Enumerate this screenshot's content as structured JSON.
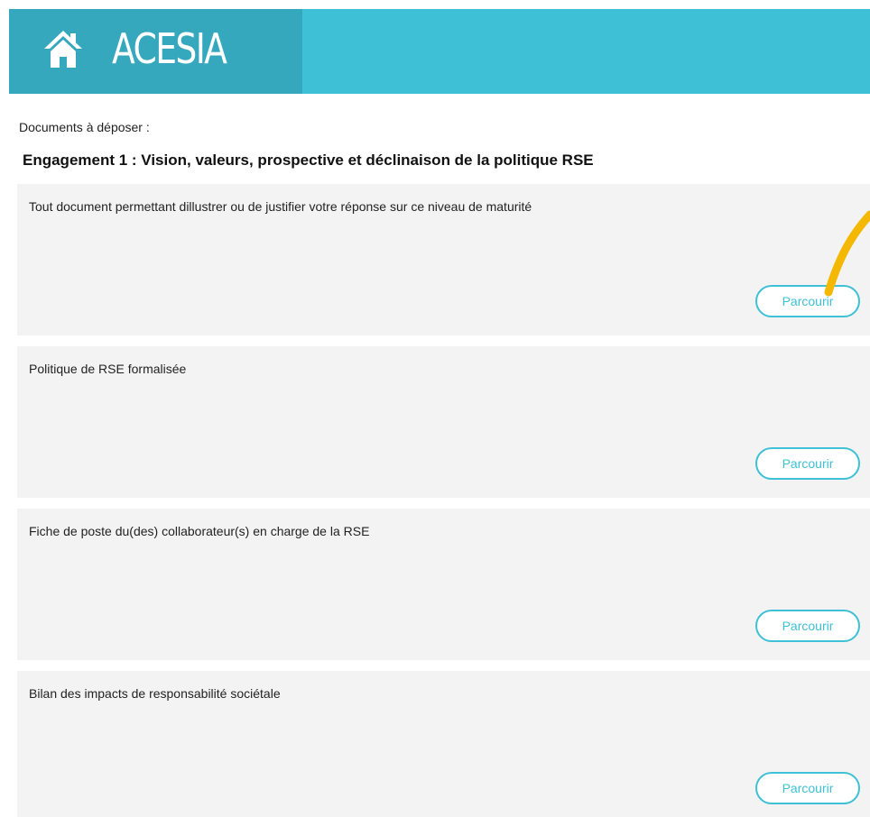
{
  "header": {
    "app_title": "ACESIA",
    "home_icon": "home-icon",
    "accent_color": "#3ec0d6",
    "logo_bg_color": "#35a8bd"
  },
  "main": {
    "documents_label": "Documents à déposer :",
    "section_title": "Engagement 1 : Vision, valeurs, prospective et déclinaison de la politique RSE",
    "documents": [
      {
        "label": "Tout document permettant dillustrer ou de justifier votre réponse sur ce niveau de maturité",
        "button_label": "Parcourir"
      },
      {
        "label": "Politique de RSE formalisée",
        "button_label": "Parcourir"
      },
      {
        "label": "Fiche de poste du(des) collaborateur(s) en charge de la RSE",
        "button_label": "Parcourir"
      },
      {
        "label": "Bilan des impacts de responsabilité sociétale",
        "button_label": "Parcourir"
      }
    ]
  },
  "annotation": {
    "arrow_color": "#f5b800"
  }
}
